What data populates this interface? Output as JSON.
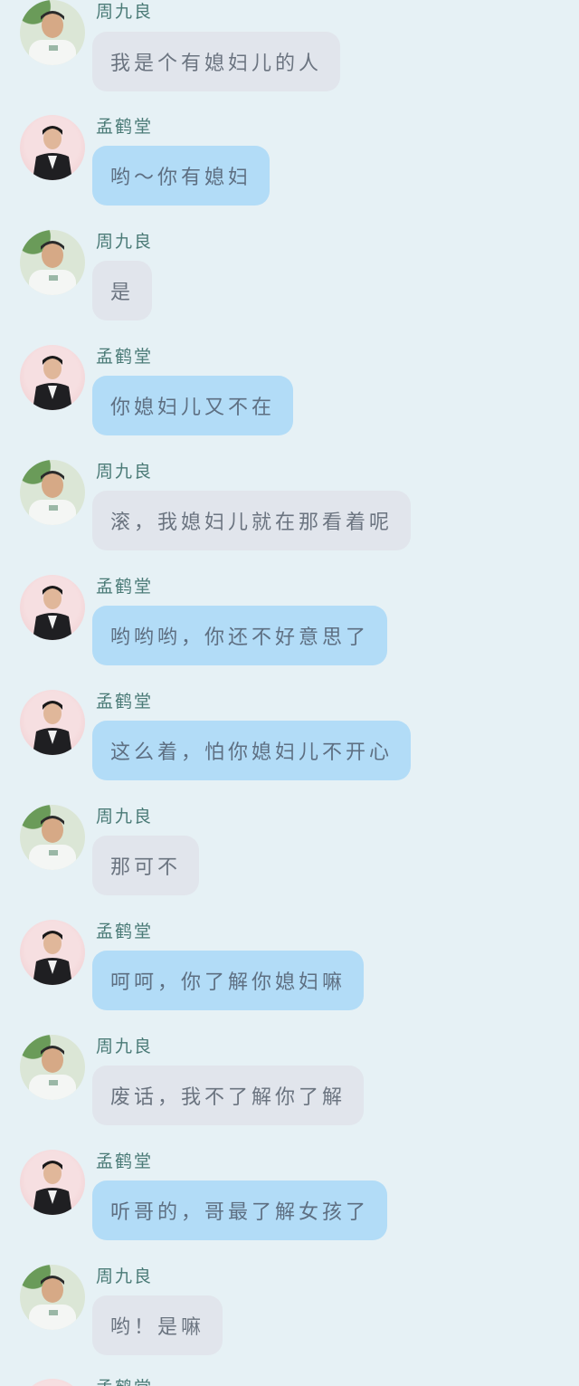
{
  "colors": {
    "background": "#e6f1f5",
    "bubble_gray": "#e1e5ec",
    "bubble_blue": "#b2dcf7",
    "name_color": "#4a7a76"
  },
  "messages": [
    {
      "sender": "周九良",
      "text": "我是个有媳妇儿的人",
      "style": "gray"
    },
    {
      "sender": "孟鹤堂",
      "text": "哟～你有媳妇",
      "style": "blue"
    },
    {
      "sender": "周九良",
      "text": "是",
      "style": "gray"
    },
    {
      "sender": "孟鹤堂",
      "text": "你媳妇儿又不在",
      "style": "blue"
    },
    {
      "sender": "周九良",
      "text": "滚，我媳妇儿就在那看着呢",
      "style": "gray"
    },
    {
      "sender": "孟鹤堂",
      "text": "哟哟哟，你还不好意思了",
      "style": "blue"
    },
    {
      "sender": "孟鹤堂",
      "text": "这么着，怕你媳妇儿不开心",
      "style": "blue"
    },
    {
      "sender": "周九良",
      "text": "那可不",
      "style": "gray"
    },
    {
      "sender": "孟鹤堂",
      "text": "呵呵，你了解你媳妇嘛",
      "style": "blue"
    },
    {
      "sender": "周九良",
      "text": "废话，我不了解你了解",
      "style": "gray"
    },
    {
      "sender": "孟鹤堂",
      "text": "听哥的，哥最了解女孩了",
      "style": "blue"
    },
    {
      "sender": "周九良",
      "text": "哟！是嘛",
      "style": "gray"
    }
  ],
  "partial_sender": "孟鹤堂"
}
